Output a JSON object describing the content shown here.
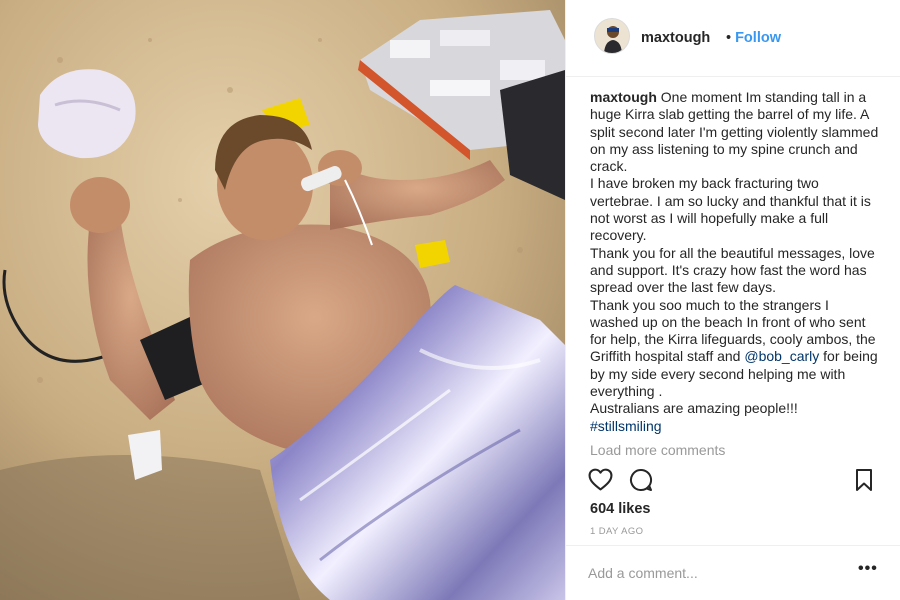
{
  "post": {
    "photo_alt": "Man lying on sand covered by emergency blanket",
    "username": "maxtough",
    "separator": "•",
    "follow_label": "Follow",
    "caption": {
      "username": "maxtough",
      "text_before_mention": " One moment Im standing tall in a huge Kirra slab getting the barrel of my life. A split second later I'm getting violently slammed on my ass listening to my spine crunch and crack.\nI have broken my back fracturing two vertebrae. I am so lucky and thankful that it is not worst as I will hopefully make a full recovery.\nThank you for all the beautiful messages, love and support. It's crazy how fast the word has spread over the last few days.\nThank you soo much to the strangers I washed up on the beach In front of who sent for help, the Kirra lifeguards, cooly ambos, the Griffith hospital staff and ",
      "mention": "@bob_carly",
      "text_after_mention": " for being by my side every second helping me with everything .\nAustralians are amazing people!!!\n",
      "hashtag": "#stillsmiling"
    },
    "load_more_label": "Load more comments",
    "likes": "604 likes",
    "time_ago": "1 DAY AGO",
    "comment_placeholder": "Add a comment...",
    "more_label": "•••"
  },
  "icons": {
    "like": "heart-icon",
    "comment": "comment-icon",
    "save": "bookmark-icon",
    "more": "more-options-icon"
  },
  "colors": {
    "follow": "#3897f0",
    "link": "#003569",
    "muted": "#999999",
    "text": "#262626",
    "border": "#efefef"
  }
}
